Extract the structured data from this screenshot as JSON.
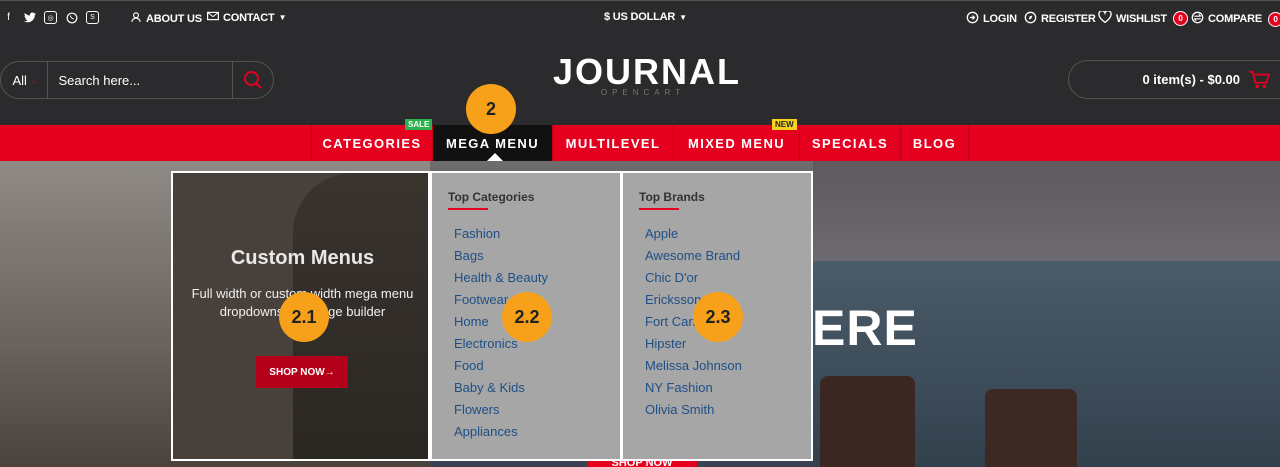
{
  "topbar": {
    "social_icons": [
      "facebook-icon",
      "twitter-icon",
      "instagram-icon",
      "whatsapp-icon",
      "skype-icon"
    ],
    "about": "ABOUT US",
    "contact": "CONTACT",
    "currency": "$ US DOLLAR",
    "login": "LOGIN",
    "register": "REGISTER",
    "wishlist": "WISHLIST",
    "wishlist_count": "0",
    "compare": "COMPARE",
    "compare_count": "0"
  },
  "header": {
    "search_category": "All",
    "search_placeholder": "Search here...",
    "logo_main": "JOURNAL",
    "logo_sub": "OPENCART",
    "cart": "0 item(s) - $0.00"
  },
  "nav": {
    "items": [
      {
        "label": "CATEGORIES",
        "tag": "SALE"
      },
      {
        "label": "MEGA MENU",
        "tag": ""
      },
      {
        "label": "MULTILEVEL",
        "tag": ""
      },
      {
        "label": "MIXED MENU",
        "tag": "NEW"
      },
      {
        "label": "SPECIALS",
        "tag": ""
      },
      {
        "label": "BLOG",
        "tag": ""
      }
    ]
  },
  "mega_menu": {
    "banner": {
      "title": "Custom Menus",
      "description": "Full width or custom width mega menu dropdowns with page builder",
      "button": "SHOP NOW"
    },
    "top_categories": {
      "heading": "Top Categories",
      "items": [
        "Fashion",
        "Bags",
        "Health & Beauty",
        "Footwear",
        "Home",
        "Electronics",
        "Food",
        "Baby & Kids",
        "Flowers",
        "Appliances"
      ]
    },
    "top_brands": {
      "heading": "Top Brands",
      "items": [
        "Apple",
        "Awesome Brand",
        "Chic D'or",
        "Ericksson",
        "Fort Canada",
        "Hipster",
        "Melissa Johnson",
        "NY Fashion",
        "Olivia Smith"
      ]
    }
  },
  "hero": {
    "headline_fragment": "ERE",
    "button": "SHOP NOW"
  },
  "annotations": [
    "2",
    "2.1",
    "2.2",
    "2.3"
  ],
  "colors": {
    "accent": "#e5001f",
    "dark": "#2b2b2e",
    "marker": "#f7a11a",
    "link": "#1e4f86"
  }
}
